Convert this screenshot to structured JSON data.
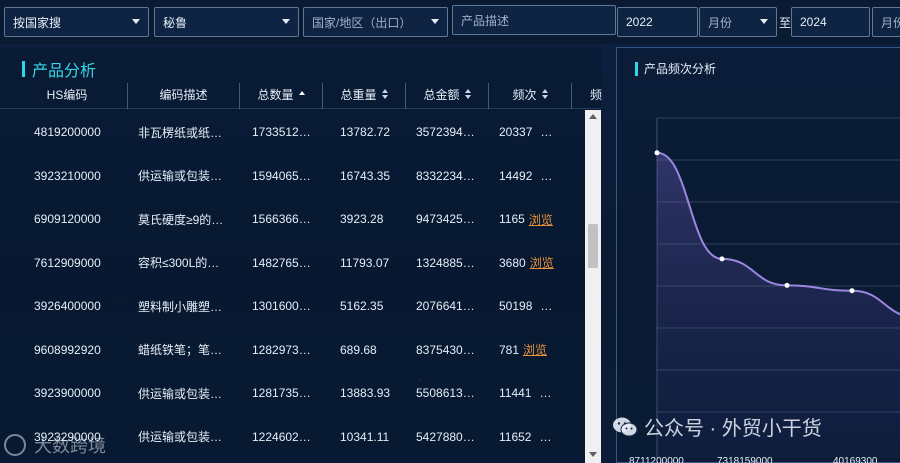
{
  "filters": {
    "search_mode": "按国家搜",
    "country": "秘鲁",
    "country_region_placeholder": "国家/地区（出口）",
    "product_desc_placeholder": "产品描述",
    "start_year": "2022",
    "start_month_placeholder": "月份",
    "to_label": "至",
    "end_year": "2024",
    "end_month_placeholder": "月份"
  },
  "product_analysis": {
    "title": "产品分析",
    "columns": [
      "HS编码",
      "编码描述",
      "总数量",
      "总重量",
      "总金额",
      "频次",
      "频"
    ],
    "browse_label": "浏览",
    "rows": [
      {
        "hs": "4819200000",
        "desc": "非瓦楞纸或纸…",
        "qty": "1733512…",
        "weight": "13782.72",
        "amount": "3572394…",
        "freq": "20337",
        "more": "…",
        "browse": false
      },
      {
        "hs": "3923210000",
        "desc": "供运输或包装…",
        "qty": "1594065…",
        "weight": "16743.35",
        "amount": "8332234…",
        "freq": "14492",
        "more": "…",
        "browse": false
      },
      {
        "hs": "6909120000",
        "desc": "莫氏硬度≥9的…",
        "qty": "1566366…",
        "weight": "3923.28",
        "amount": "9473425…",
        "freq": "1165",
        "more": "",
        "browse": true
      },
      {
        "hs": "7612909000",
        "desc": "容积≤300L的…",
        "qty": "1482765…",
        "weight": "11793.07",
        "amount": "1324885…",
        "freq": "3680",
        "more": "",
        "browse": true
      },
      {
        "hs": "3926400000",
        "desc": "塑料制小雕塑…",
        "qty": "1301600…",
        "weight": "5162.35",
        "amount": "2076641…",
        "freq": "50198",
        "more": "…",
        "browse": false
      },
      {
        "hs": "9608992920",
        "desc": "蜡纸铁笔；笔…",
        "qty": "1282973…",
        "weight": "689.68",
        "amount": "8375430…",
        "freq": "781",
        "more": "",
        "browse": true
      },
      {
        "hs": "3923900000",
        "desc": "供运输或包装…",
        "qty": "1281735…",
        "weight": "13883.93",
        "amount": "5508613…",
        "freq": "11441",
        "more": "…",
        "browse": false
      },
      {
        "hs": "3923290000",
        "desc": "供运输或包装…",
        "qty": "1224602…",
        "weight": "10341.11",
        "amount": "5427880…",
        "freq": "11652",
        "more": "…",
        "browse": false
      }
    ]
  },
  "frequency_analysis": {
    "title": "产品频次分析",
    "x_tick_labels": [
      "8711200000",
      "7318159000",
      "40169300"
    ]
  },
  "chart_data": {
    "type": "area",
    "title": "产品频次分析",
    "categories": [
      "8711200000",
      "",
      "7318159000",
      "",
      "40169300"
    ],
    "series": [
      {
        "values": [
          1.0,
          0.6,
          0.5,
          0.48,
          0.38
        ]
      }
    ],
    "grid": true,
    "line_color": "#9b86e0"
  },
  "watermarks": {
    "wechat_account": "公众号 · 外贸小干货",
    "brand": "大数跨境"
  }
}
